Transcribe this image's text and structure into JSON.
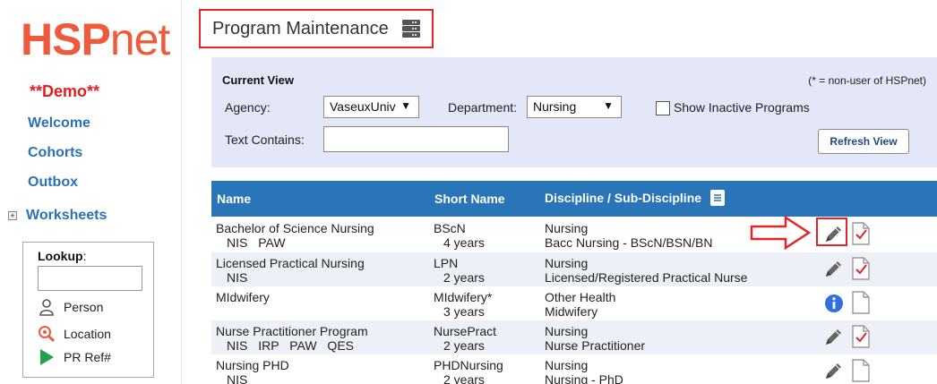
{
  "sidebar": {
    "logo_hsp": "HSP",
    "logo_net": "net",
    "demo": "**Demo**",
    "nav": {
      "welcome": "Welcome",
      "cohorts": "Cohorts",
      "outbox": "Outbox",
      "worksheets": "Worksheets"
    },
    "worksheets_toggle": "+",
    "lookup": {
      "label": "Lookup",
      "colon": ":",
      "input_value": "",
      "items": {
        "person": "Person",
        "location": "Location",
        "prref": "PR Ref#"
      }
    }
  },
  "page": {
    "title": "Program Maintenance"
  },
  "current_view": {
    "title": "Current View",
    "note": "(* = non-user of HSPnet)",
    "agency_label": "Agency:",
    "agency_value": "VaseuxUniv",
    "department_label": "Department:",
    "department_value": "Nursing",
    "text_contains_label": "Text Contains:",
    "text_contains_value": "",
    "show_inactive_label": "Show Inactive Programs",
    "refresh_label": "Refresh View",
    "dropdown_arrow": "▼"
  },
  "table": {
    "headers": {
      "name": "Name",
      "short_name": "Short Name",
      "discipline": "Discipline / Sub-Discipline"
    },
    "rows": [
      {
        "name": "Bachelor of Science Nursing",
        "tags": "NIS PAW",
        "short": "BScN",
        "years": "4 years",
        "discipline": "Nursing",
        "sub": "Bacc Nursing - BScN/BSN/BN",
        "action": "edit",
        "checked": true
      },
      {
        "name": "Licensed Practical Nursing",
        "tags": "NIS",
        "short": "LPN",
        "years": "2 years",
        "discipline": "Nursing",
        "sub": "Licensed/Registered Practical Nurse",
        "action": "edit",
        "checked": true
      },
      {
        "name": "MIdwifery",
        "tags": "",
        "short": "MIdwifery*",
        "years": "3 years",
        "discipline": "Other Health",
        "sub": "Midwifery",
        "action": "info",
        "checked": false
      },
      {
        "name": "Nurse Practitioner Program",
        "tags": "NIS IRP PAW QES",
        "short": "NursePract",
        "years": "2 years",
        "discipline": "Nursing",
        "sub": "Nurse Practitioner",
        "action": "edit",
        "checked": true
      },
      {
        "name": "Nursing PHD",
        "tags": "NIS",
        "short": "PHDNursing",
        "years": "2 years",
        "discipline": "Nursing",
        "sub": "Nursing - PhD",
        "action": "edit",
        "checked": false
      }
    ]
  },
  "colors": {
    "brand": "#ef5a3c",
    "header_blue": "#2a74b8",
    "link_blue": "#2a72b5",
    "highlight_red": "#e0262b",
    "panel": "#e3e7f8"
  }
}
